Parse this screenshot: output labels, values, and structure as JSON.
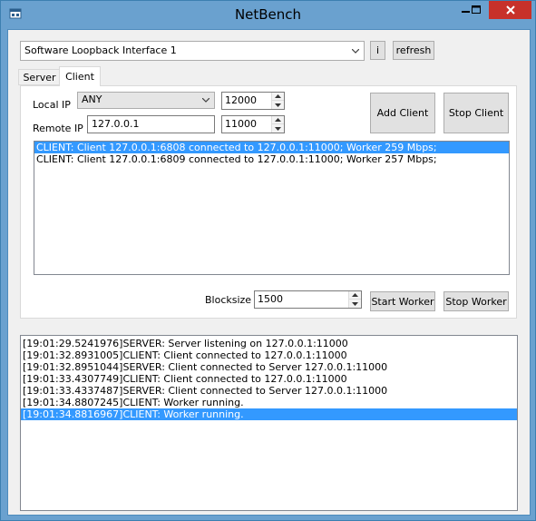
{
  "window": {
    "title": "NetBench"
  },
  "top": {
    "interface_select": "Software Loopback Interface 1",
    "info_button": "i",
    "refresh_button": "refresh"
  },
  "tabs": [
    {
      "label": "Server",
      "active": false
    },
    {
      "label": "Client",
      "active": true
    }
  ],
  "client_tab": {
    "local_ip_label": "Local IP",
    "local_ip_value": "ANY",
    "local_port": "12000",
    "remote_ip_label": "Remote IP",
    "remote_ip_value": "127.0.0.1",
    "remote_port": "11000",
    "add_client_button": "Add Client",
    "stop_client_button": "Stop Client",
    "clients": [
      "CLIENT: Client 127.0.0.1:6808 connected to 127.0.0.1:11000; Worker 259 Mbps;",
      "CLIENT: Client 127.0.0.1:6809 connected to 127.0.0.1:11000; Worker 257 Mbps;"
    ],
    "selected_client_index": 0,
    "blocksize_label": "Blocksize",
    "blocksize_value": "1500",
    "start_worker_button": "Start Worker",
    "stop_worker_button": "Stop Worker"
  },
  "log": {
    "lines": [
      "[19:01:29.5241976]SERVER: Server listening on 127.0.0.1:11000",
      "[19:01:32.8931005]CLIENT: Client connected to 127.0.0.1:11000",
      "[19:01:32.8951044]SERVER: Client connected to Server 127.0.0.1:11000",
      "[19:01:33.4307749]CLIENT: Client connected to 127.0.0.1:11000",
      "[19:01:33.4337487]SERVER: Client connected to Server 127.0.0.1:11000",
      "[19:01:34.8807245]CLIENT: Worker running.",
      "[19:01:34.8816967]CLIENT: Worker running."
    ],
    "selected_index": 6
  },
  "colors": {
    "titlebar": "#6aa1cf",
    "close_button": "#c7312a",
    "selection": "#3399ff"
  }
}
